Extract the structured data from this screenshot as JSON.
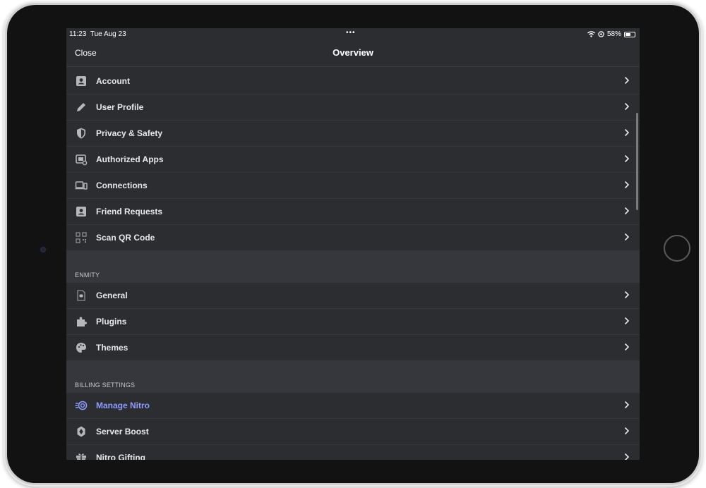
{
  "status": {
    "time": "11:23",
    "date": "Tue Aug 23",
    "dots": "•••",
    "battery_percent": "58%",
    "battery_level": 0.58
  },
  "nav": {
    "close_label": "Close",
    "title": "Overview"
  },
  "account_items": [
    {
      "label": "Account",
      "icon": "account-card-icon"
    },
    {
      "label": "User Profile",
      "icon": "pencil-icon"
    },
    {
      "label": "Privacy & Safety",
      "icon": "shield-icon"
    },
    {
      "label": "Authorized Apps",
      "icon": "authorized-apps-icon"
    },
    {
      "label": "Connections",
      "icon": "devices-icon"
    },
    {
      "label": "Friend Requests",
      "icon": "account-card-icon"
    },
    {
      "label": "Scan QR Code",
      "icon": "qr-code-icon"
    }
  ],
  "enmity": {
    "header": "ENMITY",
    "items": [
      {
        "label": "General",
        "icon": "general-icon"
      },
      {
        "label": "Plugins",
        "icon": "puzzle-icon"
      },
      {
        "label": "Themes",
        "icon": "palette-icon"
      }
    ]
  },
  "billing": {
    "header": "BILLING SETTINGS",
    "items": [
      {
        "label": "Manage Nitro",
        "icon": "nitro-icon",
        "accent": "#8e9cff"
      },
      {
        "label": "Server Boost",
        "icon": "boost-icon"
      },
      {
        "label": "Nitro Gifting",
        "icon": "gift-icon"
      }
    ]
  },
  "colors": {
    "background": "#2b2d31",
    "section_bg": "#35373c",
    "text": "#e8e8ea",
    "nitro_accent": "#8e9cff"
  }
}
